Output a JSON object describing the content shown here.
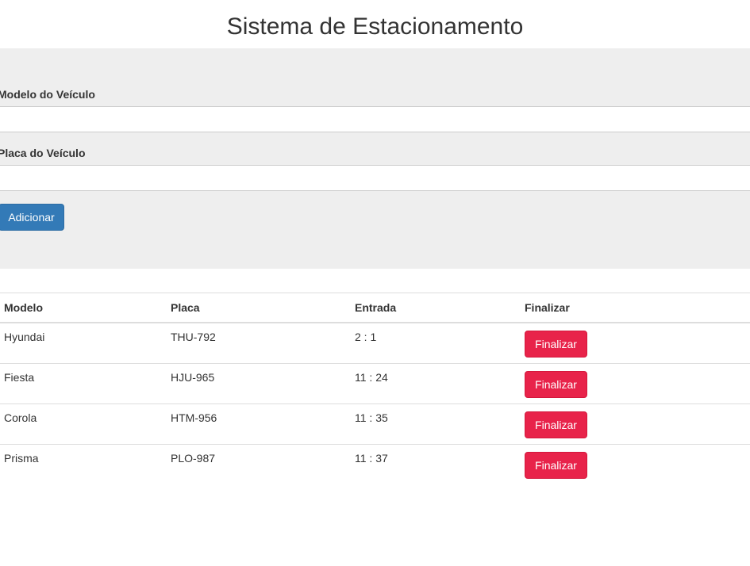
{
  "page": {
    "title": "Sistema de Estacionamento"
  },
  "form": {
    "model_label": "Modelo do Veículo",
    "model_value": "",
    "plate_label": "Placa do Veículo",
    "plate_value": "",
    "add_button": "Adicionar"
  },
  "table": {
    "headers": {
      "modelo": "Modelo",
      "placa": "Placa",
      "entrada": "Entrada",
      "finalizar": "Finalizar"
    },
    "rows": [
      {
        "modelo": "Hyundai",
        "placa": "THU-792",
        "entrada": "2 : 1",
        "action": "Finalizar"
      },
      {
        "modelo": "Fiesta",
        "placa": "HJU-965",
        "entrada": "11 : 24",
        "action": "Finalizar"
      },
      {
        "modelo": "Corola",
        "placa": "HTM-956",
        "entrada": "11 : 35",
        "action": "Finalizar"
      },
      {
        "modelo": "Prisma",
        "placa": "PLO-987",
        "entrada": "11 : 37",
        "action": "Finalizar"
      }
    ]
  },
  "colors": {
    "primary": "#337ab7",
    "danger": "#e8234a",
    "panel": "#eeeeee"
  }
}
